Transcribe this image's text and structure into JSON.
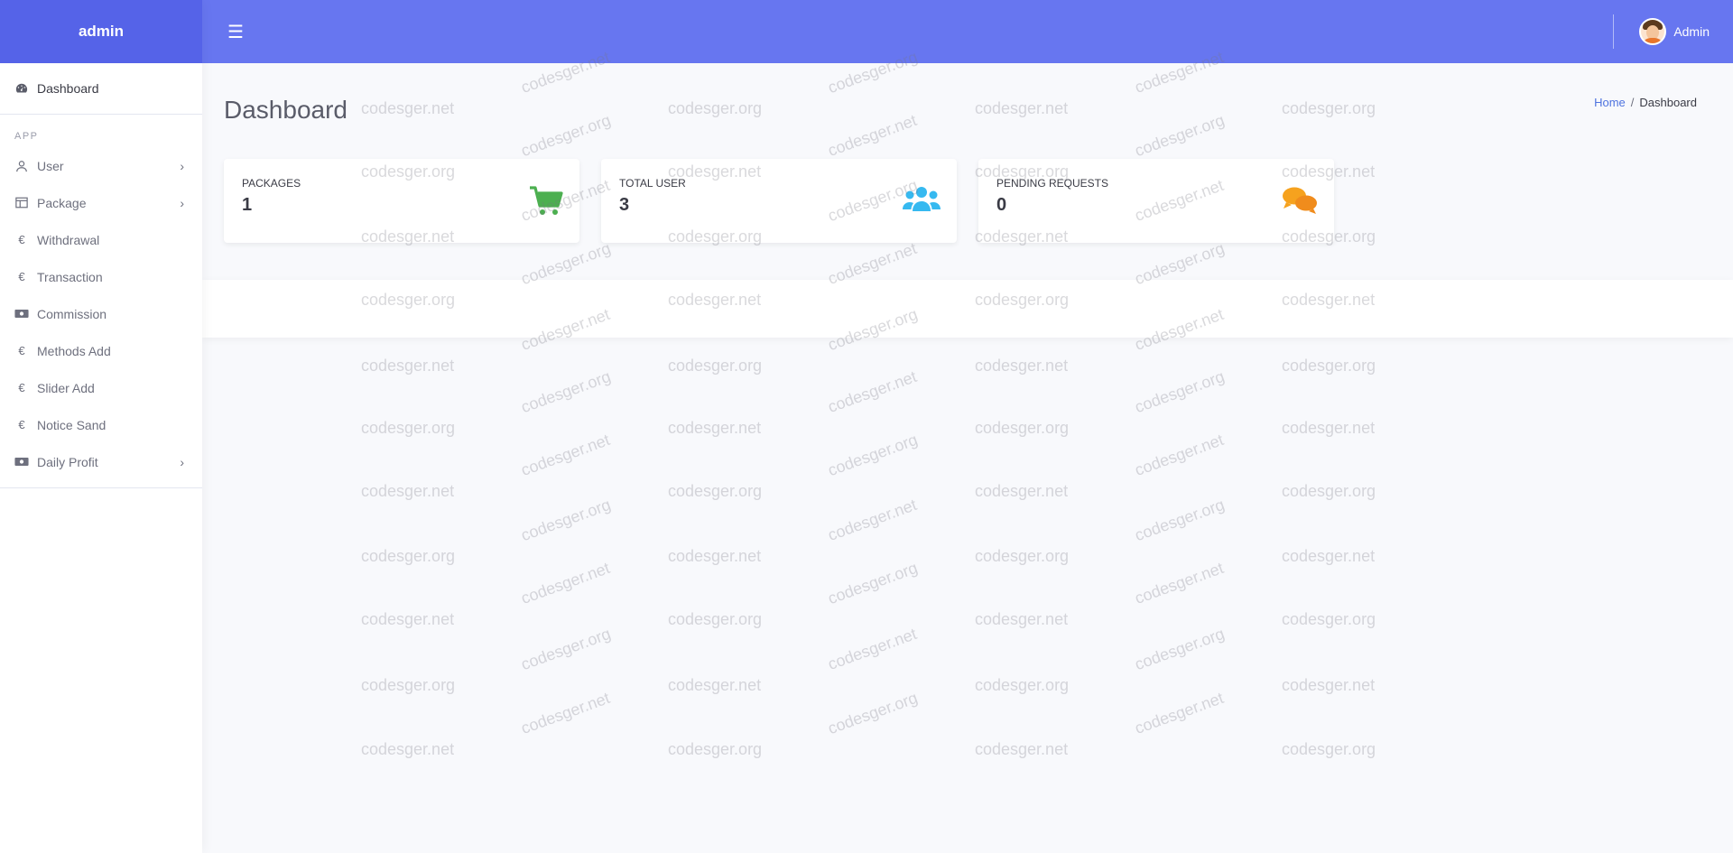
{
  "brand": {
    "title": "admin"
  },
  "topbar": {
    "user_name": "Admin"
  },
  "sidebar": {
    "active": {
      "label": "Dashboard",
      "icon": "tachometer-icon"
    },
    "section_heading": "APP",
    "items": [
      {
        "label": "User",
        "icon": "user-icon",
        "has_submenu": true
      },
      {
        "label": "Package",
        "icon": "columns-icon",
        "has_submenu": true
      },
      {
        "label": "Withdrawal",
        "icon": "euro-icon",
        "has_submenu": false
      },
      {
        "label": "Transaction",
        "icon": "euro-icon",
        "has_submenu": false
      },
      {
        "label": "Commission",
        "icon": "money-bill-icon",
        "has_submenu": false
      },
      {
        "label": "Methods Add",
        "icon": "euro-icon",
        "has_submenu": false
      },
      {
        "label": "Slider Add",
        "icon": "euro-icon",
        "has_submenu": false
      },
      {
        "label": "Notice Sand",
        "icon": "euro-icon",
        "has_submenu": false
      },
      {
        "label": "Daily Profit",
        "icon": "money-bill-icon",
        "has_submenu": true
      }
    ]
  },
  "page": {
    "title": "Dashboard"
  },
  "breadcrumb": {
    "home": "Home",
    "separator": "/",
    "current": "Dashboard"
  },
  "cards": [
    {
      "label": "PACKAGES",
      "value": "1",
      "icon": "shopping-cart-icon",
      "color": "#4caf50"
    },
    {
      "label": "TOTAL USER",
      "value": "3",
      "icon": "users-icon",
      "color": "#36b9f0"
    },
    {
      "label": "PENDING REQUESTS",
      "value": "0",
      "icon": "comments-icon",
      "color": "#f6a21e"
    }
  ],
  "colors": {
    "brand": "#5563e8",
    "topbar": "#6776f0",
    "link": "#4e73df"
  },
  "watermark": {
    "text_a": "codesger.net",
    "text_b": "codesger.org"
  }
}
